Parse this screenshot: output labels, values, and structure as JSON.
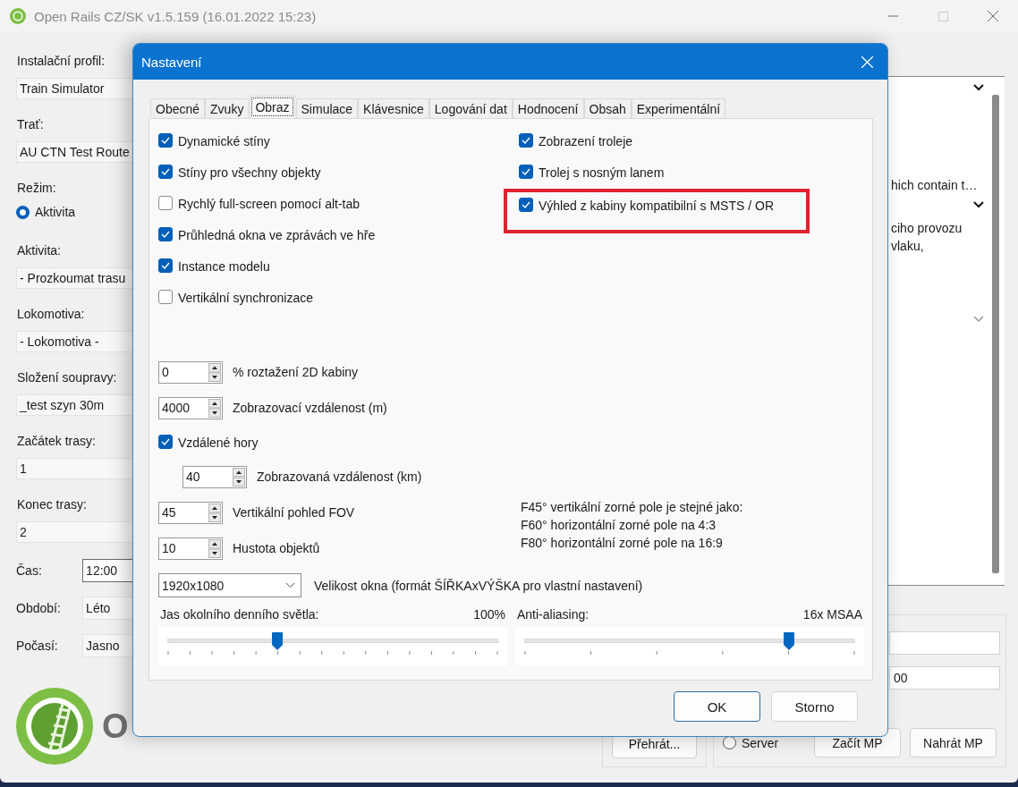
{
  "window": {
    "title": "Open Rails CZ/SK v1.5.159 (16.01.2022 15:23)"
  },
  "main_form": {
    "items": [
      {
        "kind": "field",
        "label": "Instalační profil:",
        "value": "Train Simulator"
      },
      {
        "kind": "field",
        "label": "Trať:",
        "value": "AU CTN Test Route"
      },
      {
        "kind": "radio",
        "label": "Režim:",
        "option": "Aktivita",
        "selected": true
      },
      {
        "kind": "field",
        "label": "Aktivita:",
        "value": "- Prozkoumat trasu"
      },
      {
        "kind": "field",
        "label": "Lokomotiva:",
        "value": "- Lokomotiva -"
      },
      {
        "kind": "field",
        "label": "Složení soupravy:",
        "value": "_test szyn 30m"
      },
      {
        "kind": "field",
        "label": "Začátek trasy:",
        "value": "1"
      },
      {
        "kind": "field",
        "label": "Konec trasy:",
        "value": "2"
      },
      {
        "kind": "input",
        "label": "Čas:",
        "value": "12:00"
      },
      {
        "kind": "select",
        "label": "Období:",
        "value": "Léto"
      },
      {
        "kind": "select",
        "label": "Počasí:",
        "value": "Jasno"
      }
    ],
    "logo_text": "O"
  },
  "details_panel": {
    "lines": [
      "hich contain t…",
      "ciho provozu",
      "vlaku,"
    ]
  },
  "multiplayer": {
    "port_value": "00",
    "replay_button": "Přehrát...",
    "server_option": {
      "label": "Server",
      "selected": false
    },
    "buttons": [
      "Začít MP",
      "Nahrát MP"
    ]
  },
  "dialog": {
    "title": "Nastavení",
    "tabs": [
      {
        "label": "Obecné",
        "selected": false
      },
      {
        "label": "Zvuky",
        "selected": false
      },
      {
        "label": "Obraz",
        "selected": true
      },
      {
        "label": "Simulace",
        "selected": false
      },
      {
        "label": "Klávesnice",
        "selected": false
      },
      {
        "label": "Logování dat",
        "selected": false
      },
      {
        "label": "Hodnocení",
        "selected": false
      },
      {
        "label": "Obsah",
        "selected": false
      },
      {
        "label": "Experimentální",
        "selected": false
      }
    ],
    "checkboxes_left": [
      {
        "label": "Dynamické stíny",
        "checked": true,
        "highlighted": false
      },
      {
        "label": "Stíny pro všechny objekty",
        "checked": true,
        "highlighted": false
      },
      {
        "label": "Rychlý full-screen pomocí alt-tab",
        "checked": false,
        "highlighted": false
      },
      {
        "label": "Průhledná okna ve zprávách ve hře",
        "checked": true,
        "highlighted": false
      },
      {
        "label": "Instance modelu",
        "checked": true,
        "highlighted": false
      },
      {
        "label": "Vertikální synchronizace",
        "checked": false,
        "highlighted": false
      }
    ],
    "checkboxes_right": [
      {
        "label": "Zobrazení troleje",
        "checked": true,
        "highlighted": false
      },
      {
        "label": "Trolej s nosným lanem",
        "checked": true,
        "highlighted": false
      },
      {
        "label": "Výhled z kabiny kompatibilní s MSTS / OR",
        "checked": true,
        "highlighted": true
      }
    ],
    "settings": [
      {
        "kind": "spin",
        "value": "0",
        "label": "% roztažení 2D kabiny"
      },
      {
        "kind": "spin",
        "value": "4000",
        "label": "Zobrazovací vzdálenost (m)"
      },
      {
        "kind": "checkbox",
        "label": "Vzdálené hory",
        "checked": true,
        "children": [
          {
            "kind": "spin",
            "value": "40",
            "label": "Zobrazovaná vzdálenost (km)"
          }
        ]
      }
    ],
    "fov_settings": [
      {
        "kind": "spin",
        "value": "45",
        "label": "Vertikální pohled FOV"
      },
      {
        "kind": "spin",
        "value": "10",
        "label": "Hustota objektů"
      }
    ],
    "fov_note": [
      "F45° vertikální zorné pole je stejné jako:",
      "F60° horizontální zorné pole na 4:3",
      "F80° horizontální zorné pole na 16:9"
    ],
    "window_size": {
      "value": "1920x1080",
      "label": "Velikost okna (formát ŠÍŘKAxVÝŠKA pro vlastní nastavení)"
    },
    "sliders": [
      {
        "label": "Jas okolního denního světla:",
        "reading": "100%",
        "level": 0.333,
        "kind": "fine"
      },
      {
        "label": "Anti-aliasing:",
        "reading": "16x MSAA",
        "level": 0.8,
        "kind": "coarse"
      }
    ],
    "buttons": [
      {
        "label": "OK",
        "default": true
      },
      {
        "label": "Storno",
        "default": false
      }
    ]
  }
}
